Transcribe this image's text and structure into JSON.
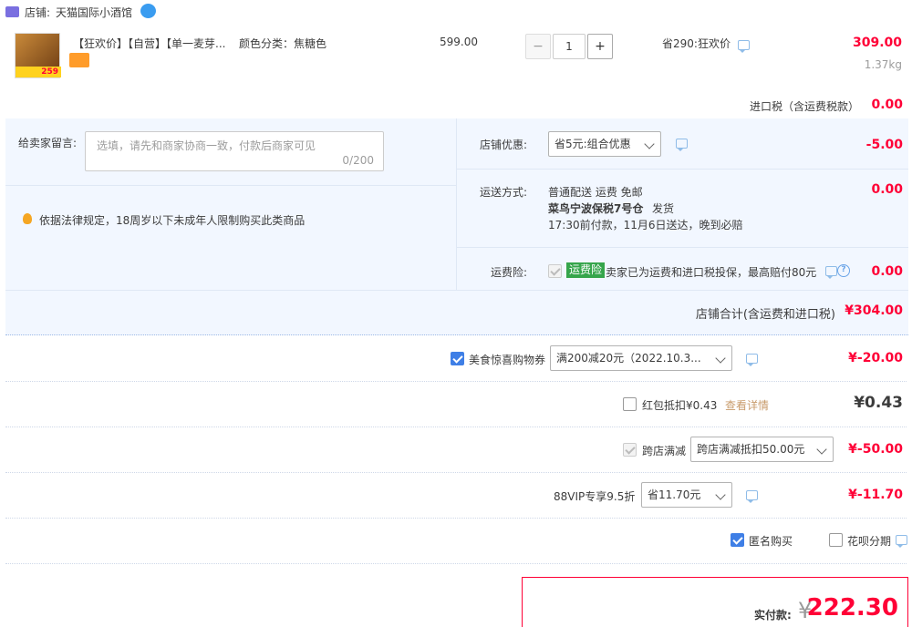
{
  "store": {
    "label": "店铺:",
    "name": "天猫国际小酒馆"
  },
  "item": {
    "title": "【狂欢价】【自营】【单一麦芽...",
    "sku_label": "颜色分类：",
    "sku_value": "焦糖色",
    "unit_price": "599.00",
    "quantity": "1",
    "minus": "−",
    "plus": "+",
    "promo": "省290:狂欢价",
    "subtotal": "309.00",
    "weight": "1.37kg",
    "thumb_price": "259"
  },
  "import_tax": {
    "label": "进口税（含运费税款）",
    "value": "0.00"
  },
  "message": {
    "label": "给卖家留言:",
    "placeholder": "选填，请先和商家协商一致，付款后商家可见",
    "counter": "0/200"
  },
  "age_notice": "依据法律规定，18周岁以下未成年人限制购买此类商品",
  "store_discount": {
    "label": "店铺优惠:",
    "selected": "省5元:组合优惠",
    "value": "-5.00"
  },
  "shipping": {
    "label": "运送方式:",
    "line1": "普通配送 运费 免邮",
    "line2": "菜鸟宁波保税7号仓",
    "line2_suffix": "发货",
    "line3": "17:30前付款，11月6日送达，晚到必赔",
    "value": "0.00"
  },
  "insurance": {
    "label": "运费险:",
    "badge": "运费险",
    "desc": "卖家已为运费和进口税投保，最高赔付80元",
    "value": "0.00"
  },
  "store_total": {
    "label": "店铺合计(含运费和进口税)",
    "value": "¥304.00"
  },
  "coupons": {
    "food": {
      "label": "美食惊喜购物券",
      "selected": "满200减20元（2022.10.3...",
      "value": "¥-20.00"
    },
    "redpacket": {
      "label": "红包抵扣¥0.43",
      "link": "查看详情",
      "value": "¥0.43"
    },
    "cross": {
      "label": "跨店满减",
      "selected": "跨店满减抵扣50.00元",
      "value": "¥-50.00"
    },
    "vip": {
      "label": "88VIP专享9.5折",
      "selected": "省11.70元",
      "value": "¥-11.70"
    }
  },
  "options": {
    "anonymous": "匿名购买",
    "huabei": "花呗分期"
  },
  "payment": {
    "label": "实付款:",
    "symbol": "¥",
    "value": "222.30"
  },
  "colors": {
    "accent": "#ff0036",
    "panel": "#f2f7ff",
    "link": "#3f7fe6"
  }
}
